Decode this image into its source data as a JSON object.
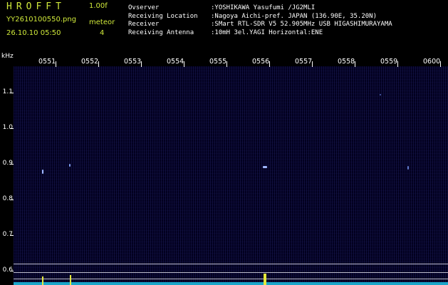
{
  "header": {
    "logo_text": "HROFFT",
    "version": "1.00f",
    "filename": "YY2610100550.png",
    "timestamp": "26.10.10 05:50",
    "meteor_label": "meteor",
    "meteor_count": "4"
  },
  "info": [
    {
      "key": "Ovserver",
      "value": ":YOSHIKAWA Yasufumi /JG2MLI"
    },
    {
      "key": "Receiving Location",
      "value": ":Nagoya Aichi-pref. JAPAN (136.90E, 35.20N)"
    },
    {
      "key": "Receiver",
      "value": ":SMart RTL-SDR V5 52.905MHz USB HIGASHIMURAYAMA"
    },
    {
      "key": "Receiving Antenna",
      "value": ":10mH 3el.YAGI Horizontal:ENE"
    }
  ],
  "axis": {
    "y_unit": "kHz",
    "y_ticks": [
      "1.1",
      "1.0",
      "0.9",
      "0.8",
      "0.7",
      "0.6"
    ],
    "x_ticks": [
      "0551",
      "0552",
      "0553",
      "0554",
      "0555",
      "0556",
      "0557",
      "0558",
      "0559",
      "0600"
    ]
  },
  "colors": {
    "label_yellow": "#cfe83a",
    "background": "#02001f",
    "spectrum": "#1aa6c9",
    "signal": "#e5e83a"
  }
}
